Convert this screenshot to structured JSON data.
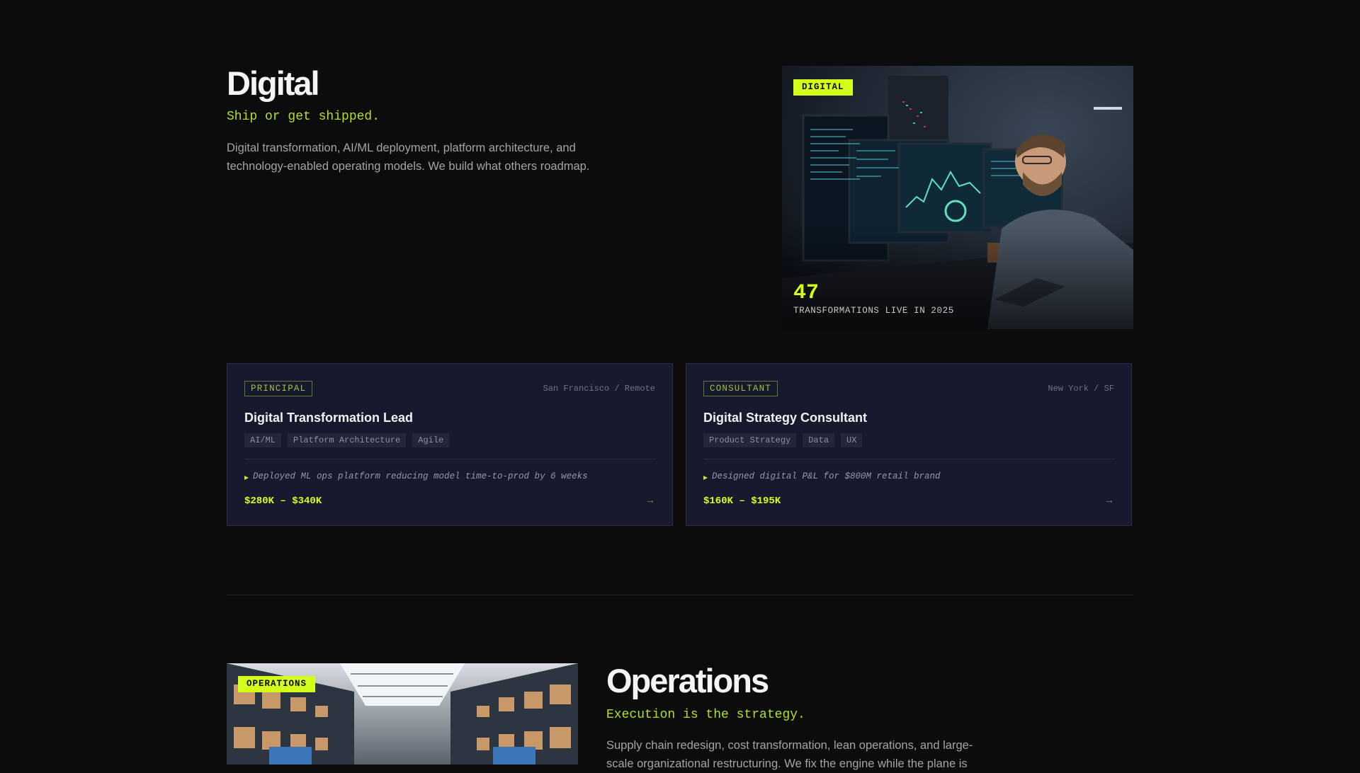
{
  "digital": {
    "title": "Digital",
    "tagline": "Ship or get shipped.",
    "description": "Digital transformation, AI/ML deployment, platform architecture, and technology-enabled operating models. We build what others roadmap.",
    "image_tag": "DIGITAL",
    "stat_value": "47",
    "stat_label": "TRANSFORMATIONS LIVE IN 2025"
  },
  "jobs": [
    {
      "level": "PRINCIPAL",
      "location": "San Francisco / Remote",
      "title": "Digital Transformation Lead",
      "tags": [
        "AI/ML",
        "Platform Architecture",
        "Agile"
      ],
      "highlight": "Deployed ML ops platform reducing model time-to-prod by 6 weeks",
      "salary": "$280K – $340K"
    },
    {
      "level": "CONSULTANT",
      "location": "New York / SF",
      "title": "Digital Strategy Consultant",
      "tags": [
        "Product Strategy",
        "Data",
        "UX"
      ],
      "highlight": "Designed digital P&L for $800M retail brand",
      "salary": "$160K – $195K"
    }
  ],
  "operations": {
    "title": "Operations",
    "tagline": "Execution is the strategy.",
    "description": "Supply chain redesign, cost transformation, lean operations, and large-scale organizational restructuring. We fix the engine while the plane is",
    "image_tag": "OPERATIONS"
  },
  "icons": {
    "card_arrow": "arrow-right-icon",
    "highlight_bullet": "triangle-right-icon"
  },
  "colors": {
    "accent": "#d4ff1a",
    "background": "#0c0c0c",
    "card_bg": "#171a2e"
  }
}
